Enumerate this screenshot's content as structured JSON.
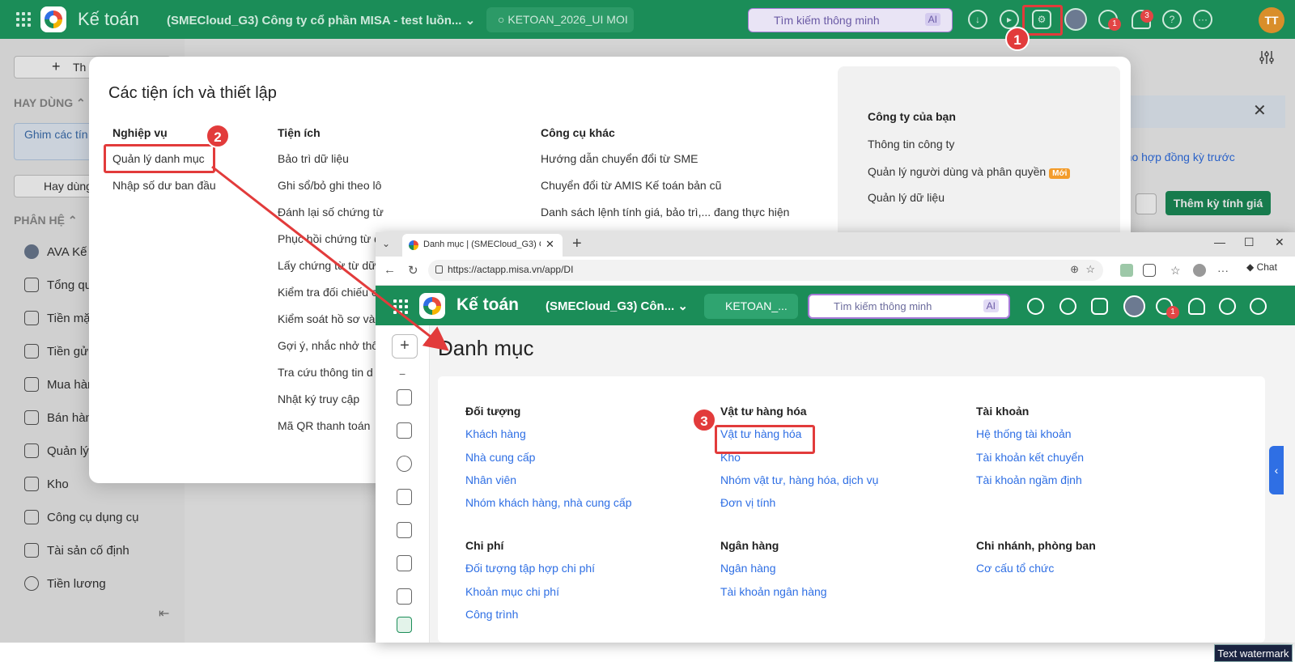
{
  "back_app": {
    "title": "Kế toán",
    "company": "(SMECloud_G3) Công ty cổ phần MISA - test luồn...",
    "database": "KETOAN_2026_UI MOI",
    "search_placeholder": "Tìm kiếm thông minh",
    "ai_label": "AI",
    "chat_badge": "1",
    "notif_badge": "3",
    "user_initials": "TT"
  },
  "sidebar": {
    "new_label": "Th",
    "favorites_header": "HAY DÙNG",
    "hint_text": "Ghim các tín dùng tại đây",
    "hay_dung_label": "Hay dùng",
    "modules_header": "PHÂN HỆ",
    "items": [
      "AVA Kế",
      "Tổng qu",
      "Tiền mặ",
      "Tiền gửi",
      "Mua hàn",
      "Bán hàn",
      "Quản lý",
      "Kho",
      "Công cụ dụng cụ",
      "Tài sản cố định",
      "Tiền lương"
    ]
  },
  "back_main": {
    "link_text": "n cho hợp đồng kỳ trước",
    "add_button": "Thêm kỳ tính giá"
  },
  "popup": {
    "title": "Các tiện ích và thiết lập",
    "col1_header": "Nghiệp vụ",
    "col1_items": [
      "Quản lý danh mục",
      "Nhập số dư ban đầu"
    ],
    "col2_header": "Tiện ích",
    "col2_items": [
      "Bảo trì dữ liệu",
      "Ghi sổ/bỏ ghi theo lô",
      "Đánh lại số chứng từ",
      "Phục hồi chứng từ d",
      "Lấy chứng từ từ dữ",
      "Kiểm tra đối chiếu c",
      "Kiểm soát hồ sơ và",
      "Gợi ý, nhắc nhở thô",
      "Tra cứu thông tin d",
      "Nhật ký truy cập",
      "Mã QR thanh toán"
    ],
    "col3_header": "Công cụ khác",
    "col3_items": [
      "Hướng dẫn chuyển đổi từ SME",
      "Chuyển đổi từ AMIS Kế toán bản cũ",
      "Danh sách lệnh tính giá, bảo trì,... đang thực hiện"
    ],
    "right_header": "Công ty của bạn",
    "right_items": [
      "Thông tin công ty",
      "Quản lý người dùng và phân quyền",
      "Quản lý dữ liệu"
    ],
    "new_badge": "Mới"
  },
  "browser": {
    "tab_title": "Danh mục | (SMECloud_G3) Công ty",
    "url": "https://actapp.misa.vn/app/DI",
    "copilot_label": "Chat"
  },
  "app": {
    "title": "Kế toán",
    "company": "(SMECloud_G3) Côn...",
    "database": "KETOAN_...",
    "search_placeholder": "Tìm kiếm thông minh",
    "ai_label": "AI",
    "chat_badge": "1"
  },
  "danh_muc": {
    "title": "Danh mục",
    "groups": [
      {
        "header": "Đối tượng",
        "items": [
          "Khách hàng",
          "Nhà cung cấp",
          "Nhân viên",
          "Nhóm khách hàng, nhà cung cấp"
        ]
      },
      {
        "header": "Vật tư hàng hóa",
        "items": [
          "Vật tư hàng hóa",
          "Kho",
          "Nhóm vật tư, hàng hóa, dịch vụ",
          "Đơn vị tính"
        ]
      },
      {
        "header": "Tài khoản",
        "items": [
          "Hệ thống tài khoản",
          "Tài khoản kết chuyển",
          "Tài khoản ngầm định"
        ]
      },
      {
        "header": "Chi phí",
        "items": [
          "Đối tượng tập hợp chi phí",
          "Khoản mục chi phí",
          "Công trình"
        ]
      },
      {
        "header": "Ngân hàng",
        "items": [
          "Ngân hàng",
          "Tài khoản ngân hàng"
        ]
      },
      {
        "header": "Chi nhánh, phòng ban",
        "items": [
          "Cơ cấu tổ chức"
        ]
      }
    ]
  },
  "annotations": [
    "1",
    "2",
    "3"
  ],
  "watermark": "Text watermark",
  "colors": {
    "brand_green": "#1b8d58",
    "link_blue": "#2f6fe4",
    "annotation_red": "#e23b3b"
  }
}
